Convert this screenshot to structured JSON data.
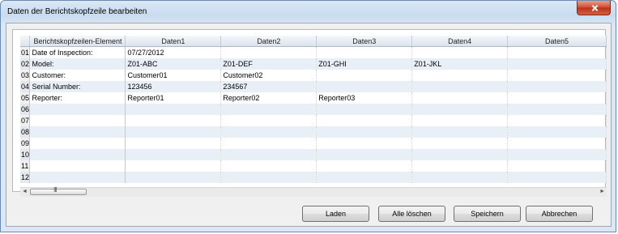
{
  "window": {
    "title": "Daten der Berichtskopfzeile bearbeiten"
  },
  "table": {
    "columns": [
      "",
      "Berichtskopfzeilen-Element",
      "Daten1",
      "Daten2",
      "Daten3",
      "Daten4",
      "Daten5"
    ],
    "rows": [
      [
        "01",
        "Date of Inspection:",
        "07/27/2012",
        "",
        "",
        "",
        ""
      ],
      [
        "02",
        "Model:",
        "Z01-ABC",
        "Z01-DEF",
        "Z01-GHI",
        "Z01-JKL",
        ""
      ],
      [
        "03",
        "Customer:",
        "Customer01",
        "Customer02",
        "",
        "",
        ""
      ],
      [
        "04",
        "Serial Number:",
        "123456",
        "234567",
        "",
        "",
        ""
      ],
      [
        "05",
        "Reporter:",
        "Reporter01",
        "Reporter02",
        "Reporter03",
        "",
        ""
      ],
      [
        "06",
        "",
        "",
        "",
        "",
        "",
        ""
      ],
      [
        "07",
        "",
        "",
        "",
        "",
        "",
        ""
      ],
      [
        "08",
        "",
        "",
        "",
        "",
        "",
        ""
      ],
      [
        "09",
        "",
        "",
        "",
        "",
        "",
        ""
      ],
      [
        "10",
        "",
        "",
        "",
        "",
        "",
        ""
      ],
      [
        "11",
        "",
        "",
        "",
        "",
        "",
        ""
      ],
      [
        "12",
        "",
        "",
        "",
        "",
        "",
        ""
      ]
    ]
  },
  "scrollbar": {
    "left_arrow": "◄",
    "right_arrow": "►",
    "grip": "III"
  },
  "buttons": {
    "load": "Laden",
    "clear_all": "Alle löschen",
    "save": "Speichern",
    "cancel": "Abbrechen"
  },
  "icons": {
    "close": "close-icon"
  }
}
